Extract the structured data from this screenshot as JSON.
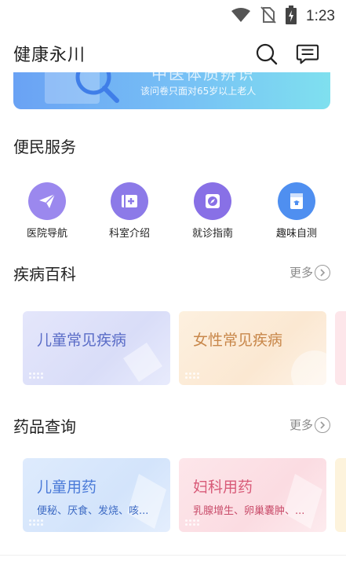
{
  "status_bar": {
    "time": "1:23"
  },
  "header": {
    "title": "健康永川"
  },
  "banner": {
    "partial_title": "中医体质辨识",
    "subtitle": "该问卷只面对65岁以上老人"
  },
  "convenience": {
    "title": "便民服务",
    "items": [
      {
        "label": "医院导航",
        "color": "#9b88ee"
      },
      {
        "label": "科室介绍",
        "color": "#8c7ae8"
      },
      {
        "label": "就诊指南",
        "color": "#8870e6"
      },
      {
        "label": "趣味自测",
        "color": "#4f8ff0"
      }
    ]
  },
  "disease": {
    "title": "疾病百科",
    "more": "更多",
    "cards": [
      {
        "title": "儿童常见疾病",
        "color": "#5a6cc7"
      },
      {
        "title": "女性常见疾病",
        "color": "#c8874a"
      }
    ]
  },
  "drug": {
    "title": "药品查询",
    "more": "更多",
    "cards": [
      {
        "title": "儿童用药",
        "desc": "便秘、厌食、发烧、咳...",
        "color": "#4a7ad8"
      },
      {
        "title": "妇科用药",
        "desc": "乳腺增生、卵巢囊肿、...",
        "color": "#d85a78"
      }
    ]
  }
}
